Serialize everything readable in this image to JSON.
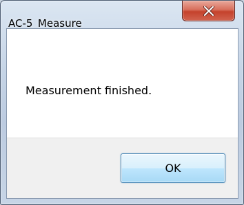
{
  "window": {
    "title": "AC-5_Measure"
  },
  "dialog": {
    "message": "Measurement finished.",
    "ok_label": "OK"
  },
  "icons": {
    "close": "close-icon"
  },
  "colors": {
    "close_button": "#c4422c",
    "ok_button_border": "#3c7fb1",
    "footer_background": "#f0f0f0"
  }
}
